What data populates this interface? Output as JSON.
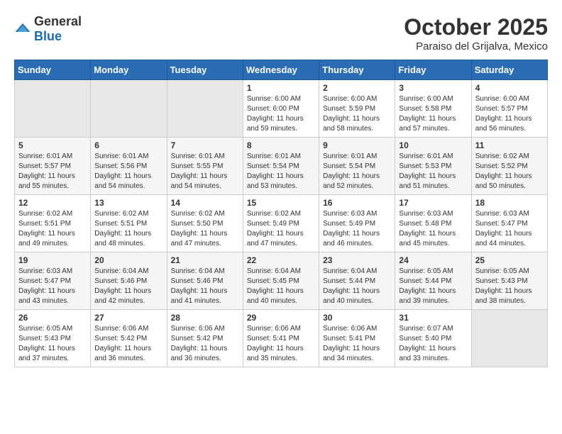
{
  "header": {
    "logo": {
      "general": "General",
      "blue": "Blue"
    },
    "title": "October 2025",
    "location": "Paraiso del Grijalva, Mexico"
  },
  "weekdays": [
    "Sunday",
    "Monday",
    "Tuesday",
    "Wednesday",
    "Thursday",
    "Friday",
    "Saturday"
  ],
  "weeks": [
    [
      {
        "day": "",
        "info": ""
      },
      {
        "day": "",
        "info": ""
      },
      {
        "day": "",
        "info": ""
      },
      {
        "day": "1",
        "info": "Sunrise: 6:00 AM\nSunset: 6:00 PM\nDaylight: 11 hours\nand 59 minutes."
      },
      {
        "day": "2",
        "info": "Sunrise: 6:00 AM\nSunset: 5:59 PM\nDaylight: 11 hours\nand 58 minutes."
      },
      {
        "day": "3",
        "info": "Sunrise: 6:00 AM\nSunset: 5:58 PM\nDaylight: 11 hours\nand 57 minutes."
      },
      {
        "day": "4",
        "info": "Sunrise: 6:00 AM\nSunset: 5:57 PM\nDaylight: 11 hours\nand 56 minutes."
      }
    ],
    [
      {
        "day": "5",
        "info": "Sunrise: 6:01 AM\nSunset: 5:57 PM\nDaylight: 11 hours\nand 55 minutes."
      },
      {
        "day": "6",
        "info": "Sunrise: 6:01 AM\nSunset: 5:56 PM\nDaylight: 11 hours\nand 54 minutes."
      },
      {
        "day": "7",
        "info": "Sunrise: 6:01 AM\nSunset: 5:55 PM\nDaylight: 11 hours\nand 54 minutes."
      },
      {
        "day": "8",
        "info": "Sunrise: 6:01 AM\nSunset: 5:54 PM\nDaylight: 11 hours\nand 53 minutes."
      },
      {
        "day": "9",
        "info": "Sunrise: 6:01 AM\nSunset: 5:54 PM\nDaylight: 11 hours\nand 52 minutes."
      },
      {
        "day": "10",
        "info": "Sunrise: 6:01 AM\nSunset: 5:53 PM\nDaylight: 11 hours\nand 51 minutes."
      },
      {
        "day": "11",
        "info": "Sunrise: 6:02 AM\nSunset: 5:52 PM\nDaylight: 11 hours\nand 50 minutes."
      }
    ],
    [
      {
        "day": "12",
        "info": "Sunrise: 6:02 AM\nSunset: 5:51 PM\nDaylight: 11 hours\nand 49 minutes."
      },
      {
        "day": "13",
        "info": "Sunrise: 6:02 AM\nSunset: 5:51 PM\nDaylight: 11 hours\nand 48 minutes."
      },
      {
        "day": "14",
        "info": "Sunrise: 6:02 AM\nSunset: 5:50 PM\nDaylight: 11 hours\nand 47 minutes."
      },
      {
        "day": "15",
        "info": "Sunrise: 6:02 AM\nSunset: 5:49 PM\nDaylight: 11 hours\nand 47 minutes."
      },
      {
        "day": "16",
        "info": "Sunrise: 6:03 AM\nSunset: 5:49 PM\nDaylight: 11 hours\nand 46 minutes."
      },
      {
        "day": "17",
        "info": "Sunrise: 6:03 AM\nSunset: 5:48 PM\nDaylight: 11 hours\nand 45 minutes."
      },
      {
        "day": "18",
        "info": "Sunrise: 6:03 AM\nSunset: 5:47 PM\nDaylight: 11 hours\nand 44 minutes."
      }
    ],
    [
      {
        "day": "19",
        "info": "Sunrise: 6:03 AM\nSunset: 5:47 PM\nDaylight: 11 hours\nand 43 minutes."
      },
      {
        "day": "20",
        "info": "Sunrise: 6:04 AM\nSunset: 5:46 PM\nDaylight: 11 hours\nand 42 minutes."
      },
      {
        "day": "21",
        "info": "Sunrise: 6:04 AM\nSunset: 5:46 PM\nDaylight: 11 hours\nand 41 minutes."
      },
      {
        "day": "22",
        "info": "Sunrise: 6:04 AM\nSunset: 5:45 PM\nDaylight: 11 hours\nand 40 minutes."
      },
      {
        "day": "23",
        "info": "Sunrise: 6:04 AM\nSunset: 5:44 PM\nDaylight: 11 hours\nand 40 minutes."
      },
      {
        "day": "24",
        "info": "Sunrise: 6:05 AM\nSunset: 5:44 PM\nDaylight: 11 hours\nand 39 minutes."
      },
      {
        "day": "25",
        "info": "Sunrise: 6:05 AM\nSunset: 5:43 PM\nDaylight: 11 hours\nand 38 minutes."
      }
    ],
    [
      {
        "day": "26",
        "info": "Sunrise: 6:05 AM\nSunset: 5:43 PM\nDaylight: 11 hours\nand 37 minutes."
      },
      {
        "day": "27",
        "info": "Sunrise: 6:06 AM\nSunset: 5:42 PM\nDaylight: 11 hours\nand 36 minutes."
      },
      {
        "day": "28",
        "info": "Sunrise: 6:06 AM\nSunset: 5:42 PM\nDaylight: 11 hours\nand 36 minutes."
      },
      {
        "day": "29",
        "info": "Sunrise: 6:06 AM\nSunset: 5:41 PM\nDaylight: 11 hours\nand 35 minutes."
      },
      {
        "day": "30",
        "info": "Sunrise: 6:06 AM\nSunset: 5:41 PM\nDaylight: 11 hours\nand 34 minutes."
      },
      {
        "day": "31",
        "info": "Sunrise: 6:07 AM\nSunset: 5:40 PM\nDaylight: 11 hours\nand 33 minutes."
      },
      {
        "day": "",
        "info": ""
      }
    ]
  ]
}
